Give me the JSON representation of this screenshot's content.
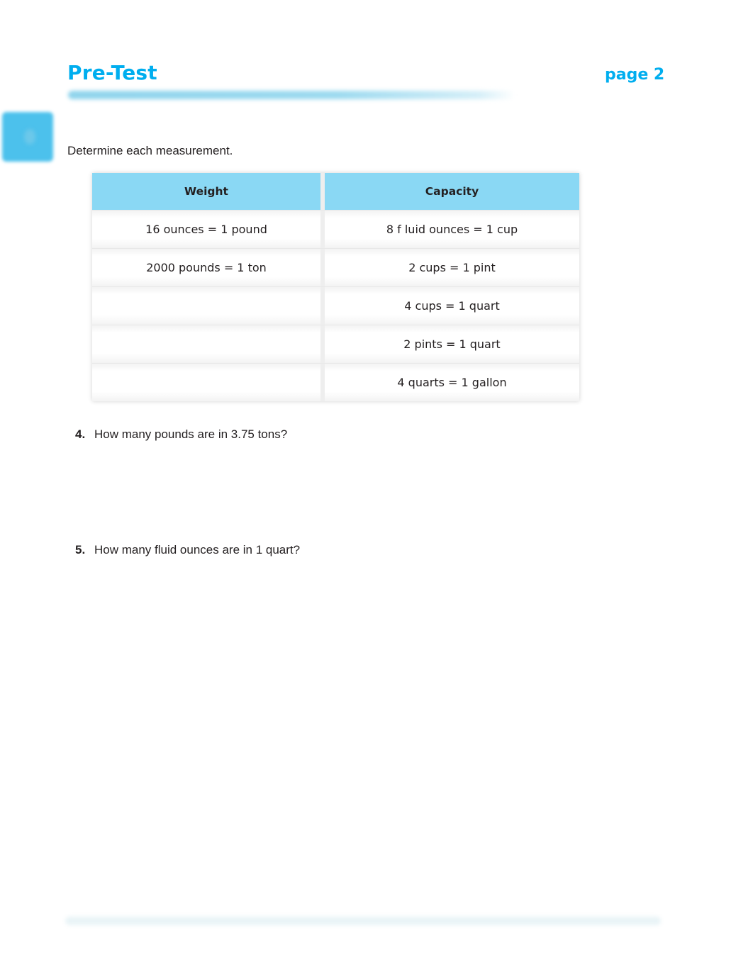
{
  "header": {
    "title": "Pre-Test",
    "page_label": "page 2",
    "accent_color": "#00aeef"
  },
  "instructions": "Determine each measurement.",
  "conversion_table": {
    "header_color": "#8ad8f4",
    "columns": [
      "Weight",
      "Capacity"
    ],
    "rows": [
      [
        "16 ounces = 1 pound",
        "8 f luid ounces = 1 cup"
      ],
      [
        "2000 pounds = 1 ton",
        "2 cups = 1 pint"
      ],
      [
        "",
        "4 cups = 1 quart"
      ],
      [
        "",
        "2 pints = 1 quart"
      ],
      [
        "",
        "4 quarts = 1 gallon"
      ]
    ]
  },
  "questions": [
    {
      "number": "4.",
      "text": "How many pounds are in 3.75 tons?"
    },
    {
      "number": "5.",
      "text": "How many fluid ounces are in 1 quart?"
    }
  ]
}
